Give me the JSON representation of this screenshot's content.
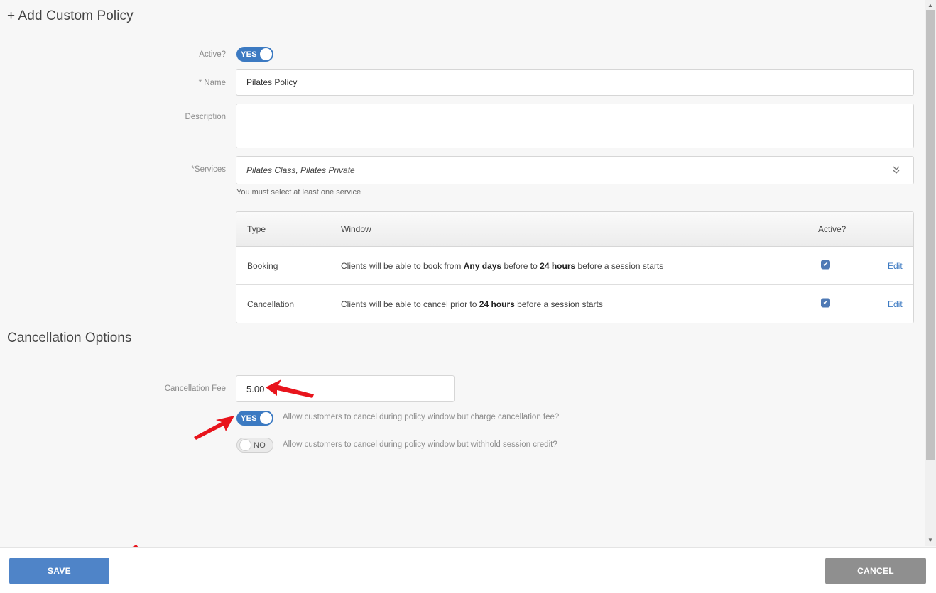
{
  "page": {
    "title": "+ Add Custom Policy"
  },
  "form": {
    "active_label": "Active?",
    "active_toggle": "YES",
    "name_label": "* Name",
    "name_value": "Pilates Policy",
    "description_label": "Description",
    "description_value": "",
    "services_label": "*Services",
    "services_value": "Pilates Class, Pilates Private",
    "services_hint": "You must select at least one service"
  },
  "table": {
    "headers": {
      "type": "Type",
      "window": "Window",
      "active": "Active?"
    },
    "rows": [
      {
        "type": "Booking",
        "window_parts": [
          "Clients will be able to book from ",
          "Any days",
          " before to ",
          "24 hours",
          " before a session starts"
        ],
        "active": true,
        "edit": "Edit"
      },
      {
        "type": "Cancellation",
        "window_parts": [
          "Clients will be able to cancel prior to ",
          "24 hours",
          " before a session starts"
        ],
        "active": true,
        "edit": "Edit"
      }
    ]
  },
  "cancellation": {
    "section_title": "Cancellation Options",
    "fee_label": "Cancellation Fee",
    "fee_value": "5.00",
    "option1_toggle": "YES",
    "option1_text": "Allow customers to cancel during policy window but charge cancellation fee?",
    "option2_toggle": "NO",
    "option2_text": "Allow customers to cancel during policy window but withhold session credit?"
  },
  "footer": {
    "save": "SAVE",
    "cancel": "CANCEL"
  },
  "icons": {
    "services_dropdown": "double-chevron-down-icon",
    "checkbox": "check-icon",
    "annotation": "red-arrow-icon"
  },
  "colors": {
    "accent": "#3c7ac2",
    "save_button": "#4f84c8",
    "cancel_button": "#8f8f8f",
    "annotation": "#e8141c"
  }
}
